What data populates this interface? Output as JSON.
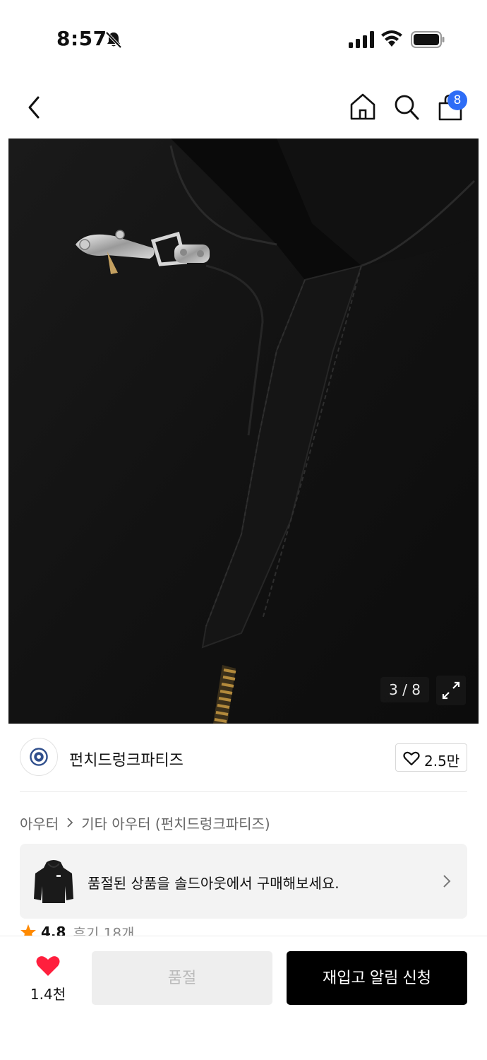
{
  "status_bar": {
    "time": "8:57"
  },
  "nav": {
    "cart_badge": "8"
  },
  "gallery": {
    "counter": "3 / 8"
  },
  "brand": {
    "name": "펀치드렁크파티즈",
    "like_count": "2.5만"
  },
  "breadcrumb": {
    "items": [
      "아우터",
      "기타 아우터 (펀치드렁크파티즈)"
    ]
  },
  "soldout_banner": {
    "text": "품절된 상품을 솔드아웃에서 구매해보세요."
  },
  "rating": {
    "value": "4.8",
    "reviews": "후기 18개"
  },
  "bottom_bar": {
    "wish_count": "1.4천",
    "soldout_label": "품절",
    "restock_label": "재입고 알림 신청"
  },
  "colors": {
    "accent_blue": "#2e6df6",
    "heart_red": "#ff1f3d",
    "star_orange": "#ff8a00",
    "primary_black": "#000000"
  },
  "icons": [
    "bell-muted-icon",
    "signal-icon",
    "wifi-icon",
    "battery-icon",
    "back-icon",
    "home-icon",
    "search-icon",
    "shopping-bag-icon",
    "expand-icon",
    "heart-outline-icon",
    "chevron-right-icon",
    "star-icon",
    "heart-filled-icon"
  ]
}
